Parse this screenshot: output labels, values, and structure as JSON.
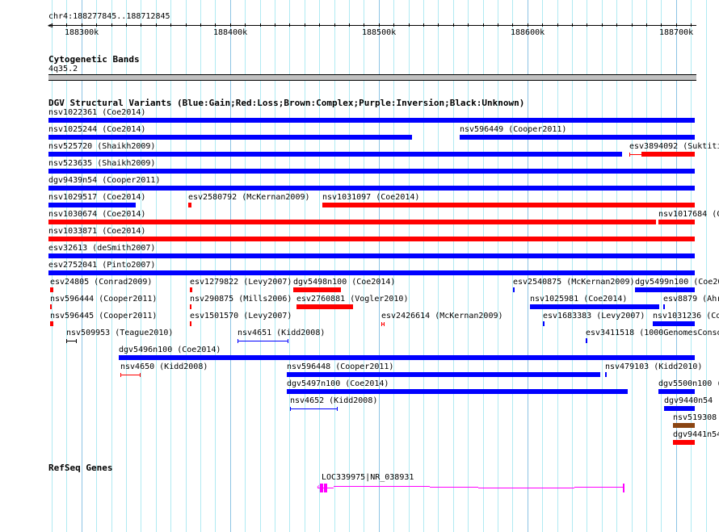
{
  "ruler": {
    "location": "chr4:188277845..188712845",
    "start_kb": 188277.845,
    "end_kb": 188712.845,
    "tick_labels": [
      "188300k",
      "188400k",
      "188500k",
      "188600k",
      "188700k"
    ],
    "arrow_icon": "left-arrow-icon"
  },
  "colors": {
    "gain": "#0000ff",
    "loss": "#ff0000",
    "complex": "#8b4513",
    "inversion": "#800080",
    "unknown": "#000000",
    "gene": "#ff00ff",
    "grid": "#b0eaf2",
    "grid_major": "#8cc4e4",
    "band": "#c0c0c0"
  },
  "cyto": {
    "title": "Cytogenetic Bands",
    "band": "4q35.2"
  },
  "dgv": {
    "title": "DGV Structural Variants (Blue:Gain;Red:Loss;Brown:Complex;Purple:Inversion;Black:Unknown)",
    "rows": [
      [
        {
          "label": "nsv1022361 (Coe2014)",
          "type": "gain",
          "start": 188277.8,
          "end": 188712.8
        }
      ],
      [
        {
          "label": "nsv1025244 (Coe2014)",
          "type": "gain",
          "start": 188277.8,
          "end": 188522.4
        },
        {
          "label": "nsv596449 (Cooper2011)",
          "type": "gain",
          "start": 188554.4,
          "end": 188712.8
        }
      ],
      [
        {
          "label": "nsv525720 (Shaikh2009)",
          "type": "gain",
          "start": 188277.8,
          "end": 188663.7
        },
        {
          "label": "esv3894092 (Suktiti",
          "type": "loss",
          "start": 188668.6,
          "end": 188712.8,
          "thin_until": 188676.7
        }
      ],
      [
        {
          "label": "nsv523635 (Shaikh2009)",
          "type": "gain",
          "start": 188277.8,
          "end": 188712.8
        }
      ],
      [
        {
          "label": "dgv9439n54 (Cooper2011)",
          "type": "gain",
          "start": 188277.8,
          "end": 188712.8
        }
      ],
      [
        {
          "label": "nsv1029517 (Coe2014)",
          "type": "gain",
          "start": 188277.8,
          "end": 188336.5
        },
        {
          "label": "esv2580792 (McKernan2009)",
          "type": "loss",
          "start": 188371.8,
          "end": 188374.0
        },
        {
          "label": "nsv1031097 (Coe2014)",
          "type": "loss",
          "start": 188462.0,
          "end": 188712.8
        }
      ],
      [
        {
          "label": "nsv1030674 (Coe2014)",
          "type": "loss",
          "start": 188277.8,
          "end": 188686.5
        },
        {
          "label": "nsv1017684 (C",
          "type": "loss",
          "start": 188688.1,
          "end": 188712.8
        }
      ],
      [
        {
          "label": "nsv1033871 (Coe2014)",
          "type": "loss",
          "start": 188277.8,
          "end": 188712.8
        }
      ],
      [
        {
          "label": "esv32613 (deSmith2007)",
          "type": "gain",
          "start": 188277.8,
          "end": 188712.8
        }
      ],
      [
        {
          "label": "esv2752041 (Pinto2007)",
          "type": "gain",
          "start": 188277.8,
          "end": 188712.8
        }
      ],
      [
        {
          "label": "esv24805 (Conrad2009)",
          "type": "loss",
          "start": 188278.9,
          "end": 188281.1
        },
        {
          "label": "esv1279822 (Levy2007)",
          "type": "loss",
          "start": 188372.9,
          "end": 188374.5
        },
        {
          "label": "dgv5498n100 (Coe2014)",
          "type": "loss",
          "start": 188442.5,
          "end": 188474.5
        },
        {
          "label": "esv2540875 (McKernan2009)",
          "type": "gain",
          "start": 188590.3,
          "end": 188591.4
        },
        {
          "label": "dgv5499n100 (Coe20",
          "type": "gain",
          "start": 188672.4,
          "end": 188712.8
        }
      ],
      [
        {
          "label": "nsv596444 (Cooper2011)",
          "type": "loss",
          "start": 188278.9,
          "end": 188279.4
        },
        {
          "label": "nsv290875 (Mills2006)",
          "type": "loss",
          "start": 188372.9,
          "end": 188374.0
        },
        {
          "label": "esv2760881 (Vogler2010)",
          "type": "loss",
          "start": 188444.6,
          "end": 188482.7
        },
        {
          "label": "nsv1025981 (Coe2014)",
          "type": "gain",
          "start": 188601.7,
          "end": 188688.7
        },
        {
          "label": "esv8879 (Ahr",
          "type": "gain",
          "start": 188691.4,
          "end": 188692.5
        }
      ],
      [
        {
          "label": "nsv596445 (Cooper2011)",
          "type": "loss",
          "start": 188278.9,
          "end": 188281.1
        },
        {
          "label": "esv1501570 (Levy2007)",
          "type": "loss",
          "start": 188372.9,
          "end": 188374.0
        },
        {
          "label": "esv2426614 (McKernan2009)",
          "type": "loss",
          "start": 188501.7,
          "end": 188503.9,
          "style": "interval"
        },
        {
          "label": "esv1683383 (Levy2007)",
          "type": "gain",
          "start": 188610.4,
          "end": 188611.5
        },
        {
          "label": "nsv1031236 (Co",
          "type": "gain",
          "start": 188684.3,
          "end": 188712.8
        }
      ],
      [
        {
          "label": "nsv509953 (Teague2010)",
          "type": "unknown",
          "start": 188289.8,
          "end": 188296.8,
          "style": "interval"
        },
        {
          "label": "nsv4651 (Kidd2008)",
          "type": "gain",
          "start": 188405.0,
          "end": 188439.2,
          "style": "interval"
        },
        {
          "label": "esv3411518 (1000GenomesConso",
          "type": "gain",
          "start": 188639.2,
          "end": 188640.3
        }
      ],
      [
        {
          "label": "dgv5496n100 (Coe2014)",
          "type": "gain",
          "start": 188325.1,
          "end": 188712.8
        }
      ],
      [
        {
          "label": "nsv4650 (Kidd2008)",
          "type": "loss",
          "start": 188326.2,
          "end": 188339.8,
          "style": "interval"
        },
        {
          "label": "nsv596448 (Cooper2011)",
          "type": "gain",
          "start": 188438.1,
          "end": 188649.0
        },
        {
          "label": "nsv479103 (Kidd2010)",
          "type": "gain",
          "start": 188652.3,
          "end": 188653.3
        }
      ],
      [
        {
          "label": "dgv5497n100 (Coe2014)",
          "type": "gain",
          "start": 188438.1,
          "end": 188667.5
        },
        {
          "label": "dgv5500n100 (",
          "type": "gain",
          "start": 188688.1,
          "end": 188712.8
        }
      ],
      [
        {
          "label": "nsv4652 (Kidd2008)",
          "type": "gain",
          "start": 188440.3,
          "end": 188472.4,
          "style": "interval"
        },
        {
          "label": "dgv9440n54 (",
          "type": "gain",
          "start": 188691.9,
          "end": 188712.8
        }
      ],
      [
        {
          "label": "nsv519308",
          "type": "complex",
          "start": 188697.9,
          "end": 188712.8
        }
      ],
      [
        {
          "label": "dgv9441n54",
          "type": "loss",
          "start": 188697.9,
          "end": 188712.8
        }
      ]
    ]
  },
  "refseq": {
    "title": "RefSeq Genes",
    "genes": [
      {
        "label": "LOC339975|NR_038931",
        "strand": "-",
        "start": 188458.8,
        "end": 188664.2,
        "exons": [
          [
            188460.7,
            188462.4
          ],
          [
            188462.9,
            188463.5
          ],
          [
            188464.1,
            188464.6
          ],
          [
            188664.0,
            188664.2
          ]
        ]
      }
    ]
  }
}
